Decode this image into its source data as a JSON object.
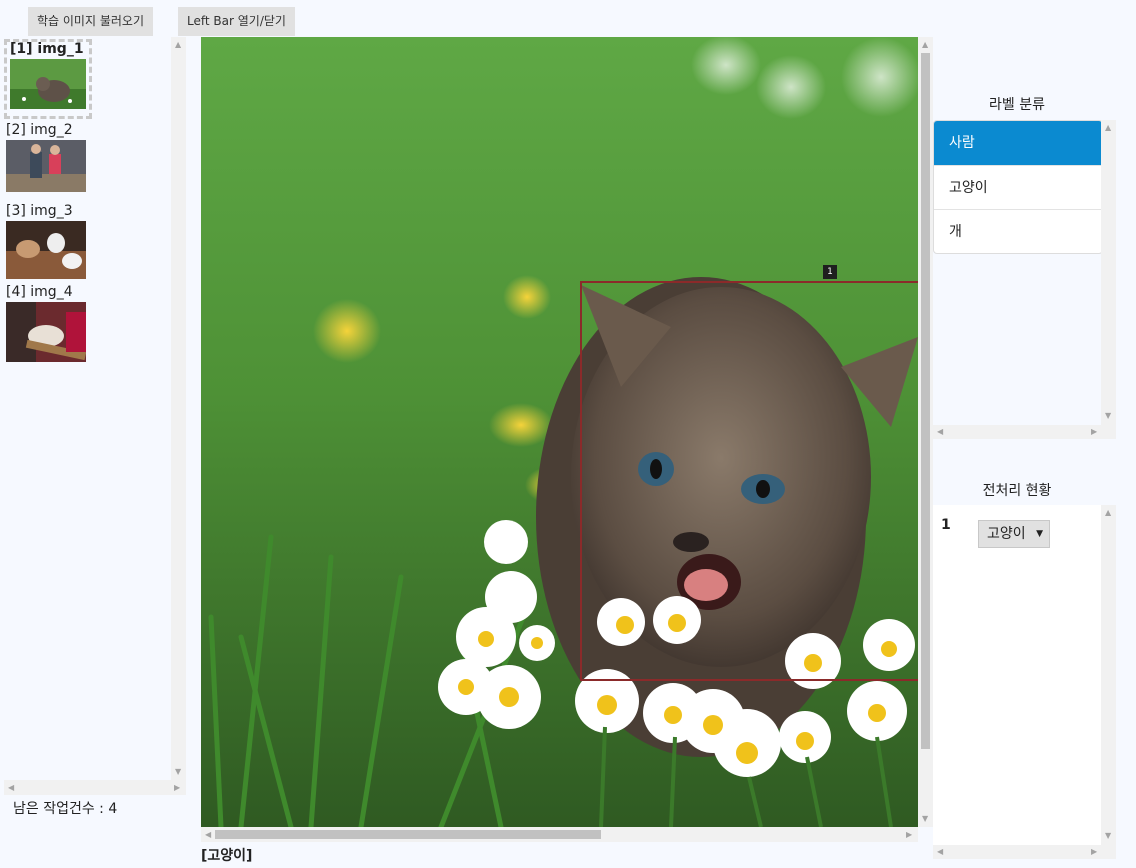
{
  "toolbar": {
    "load_images_label": "학습 이미지 불러오기",
    "left_bar_label": "Left Bar 열기/닫기"
  },
  "thumbnails": [
    {
      "label": "[1] img_1",
      "selected": true
    },
    {
      "label": "[2] img_2",
      "selected": false
    },
    {
      "label": "[3] img_3",
      "selected": false
    },
    {
      "label": "[4] img_4",
      "selected": false
    }
  ],
  "remaining": "남은 작업건수 : 4",
  "viewer": {
    "box_tag": "1",
    "caption": "[고양이]"
  },
  "label_panel": {
    "title": "라벨 분류",
    "classes": [
      "사람",
      "고양이",
      "개"
    ],
    "active_index": 0
  },
  "preprocess_panel": {
    "title": "전처리 현황",
    "rows": [
      {
        "index": "1",
        "class_value": "고양이"
      }
    ]
  },
  "colors": {
    "active_class": "#0b8ad0",
    "bbox": "#8b2a2a"
  }
}
